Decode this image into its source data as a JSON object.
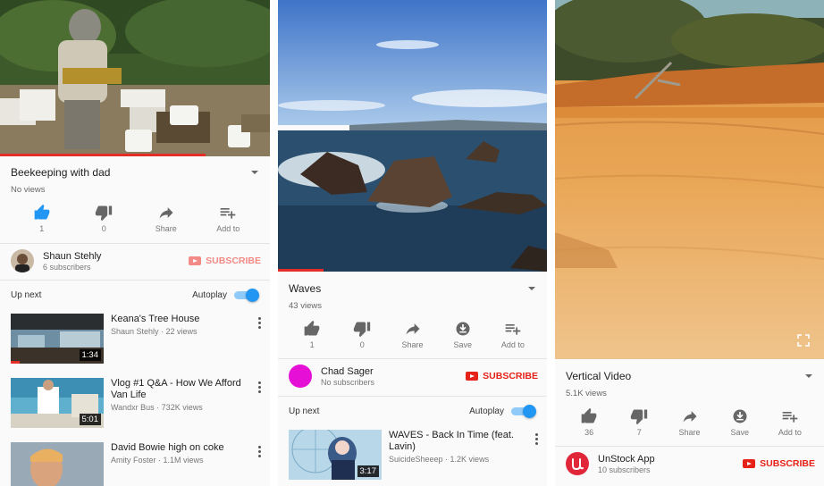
{
  "panels": [
    {
      "video": {
        "progress_fraction": 0.76
      },
      "title": "Beekeeping with dad",
      "views": "No views",
      "actions": [
        {
          "icon": "thumbs-up-icon",
          "label": "1"
        },
        {
          "icon": "thumbs-down-icon",
          "label": "0"
        },
        {
          "icon": "share-icon",
          "label": "Share"
        },
        {
          "icon": "add-to-playlist-icon",
          "label": "Add to"
        }
      ],
      "channel": {
        "name": "Shaun Stehly",
        "subs": "6 subscribers",
        "subscribe": "SUBSCRIBE"
      },
      "up_next": "Up next",
      "autoplay": "Autoplay",
      "related": [
        {
          "title": "Keana's Tree House",
          "meta": "Shaun Stehly · 22 views",
          "duration": "1:34"
        },
        {
          "title": "Vlog #1 Q&A - How We Afford Van Life",
          "meta": "Wandxr Bus · 732K views",
          "duration": "5:01"
        },
        {
          "title": "David Bowie high on coke",
          "meta": "Amity Foster · 1.1M views",
          "duration": ""
        }
      ]
    },
    {
      "video": {
        "progress_fraction": 0.17
      },
      "title": "Waves",
      "views": "43 views",
      "actions": [
        {
          "icon": "thumbs-up-icon",
          "label": "1"
        },
        {
          "icon": "thumbs-down-icon",
          "label": "0"
        },
        {
          "icon": "share-icon",
          "label": "Share"
        },
        {
          "icon": "save-icon",
          "label": "Save"
        },
        {
          "icon": "add-to-playlist-icon",
          "label": "Add to"
        }
      ],
      "channel": {
        "name": "Chad Sager",
        "subs": "No subscribers",
        "subscribe": "SUBSCRIBE"
      },
      "up_next": "Up next",
      "autoplay": "Autoplay",
      "related": [
        {
          "title": "WAVES - Back In Time (feat. Lavin)",
          "meta": "SuicideSheeep · 1.2K views",
          "duration": "3:17"
        }
      ]
    },
    {
      "video": {
        "progress_fraction": 0
      },
      "title": "Vertical Video",
      "views": "5.1K views",
      "actions": [
        {
          "icon": "thumbs-up-icon",
          "label": "36"
        },
        {
          "icon": "thumbs-down-icon",
          "label": "7"
        },
        {
          "icon": "share-icon",
          "label": "Share"
        },
        {
          "icon": "save-icon",
          "label": "Save"
        },
        {
          "icon": "add-to-playlist-icon",
          "label": "Add to"
        }
      ],
      "channel": {
        "name": "UnStock App",
        "subs": "10 subscribers",
        "subscribe": "SUBSCRIBE"
      }
    }
  ],
  "colors": {
    "accent": "#2196f3",
    "brand_red": "#e62117",
    "progress": "#e52d27"
  }
}
